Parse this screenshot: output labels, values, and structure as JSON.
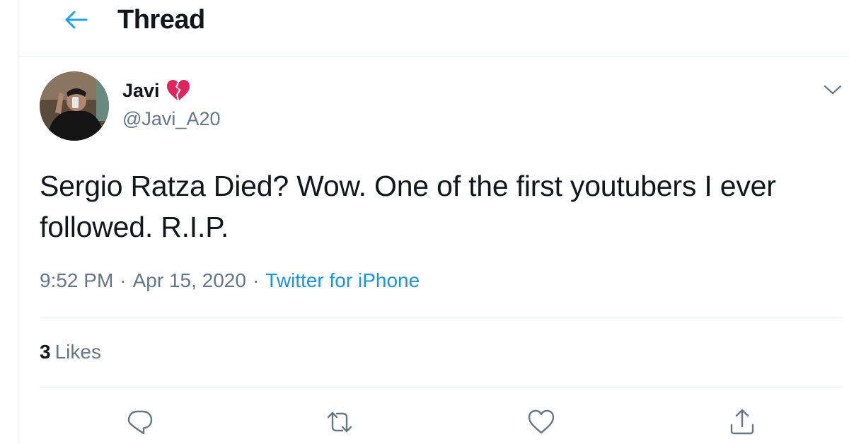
{
  "header": {
    "title": "Thread"
  },
  "author": {
    "display_name": "Javi",
    "name_emoji": "broken-heart-icon",
    "handle": "@Javi_A20"
  },
  "tweet": {
    "text": "Sergio Ratza Died? Wow. One of the first youtubers I ever followed. R.I.P.",
    "time": "9:52 PM",
    "date": "Apr 15, 2020",
    "separator": "·",
    "source": "Twitter for iPhone"
  },
  "stats": {
    "likes_count": "3",
    "likes_label": "Likes"
  },
  "actions": [
    "reply-icon",
    "retweet-icon",
    "like-icon",
    "share-icon"
  ],
  "colors": {
    "accent": "#1b95e0",
    "text": "#14171a",
    "secondary": "#657786",
    "border": "#e6ecf0",
    "heart": "#e0245e"
  }
}
